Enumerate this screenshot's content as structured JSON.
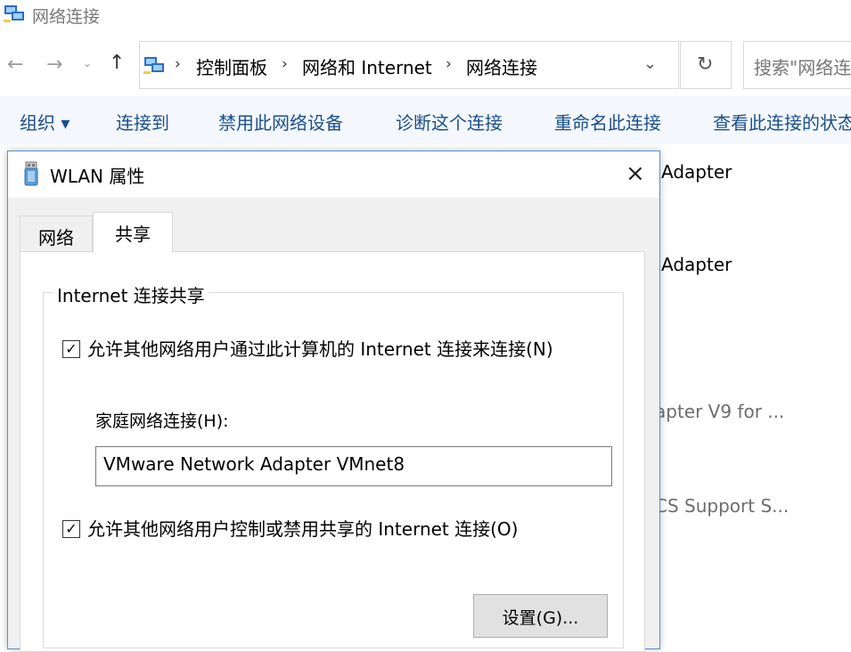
{
  "window": {
    "title": "网络连接"
  },
  "nav": {
    "back": "←",
    "forward": "→",
    "history": "⌄",
    "up": "↑",
    "refresh": "↻",
    "address_dropdown": "⌄"
  },
  "breadcrumb": {
    "items": [
      "控制面板",
      "网络和 Internet",
      "网络连接"
    ],
    "separator": "›"
  },
  "search": {
    "placeholder": "搜索\"网络连"
  },
  "command_bar": {
    "organize": "组织 ▾",
    "connect_to": "连接到",
    "disable_device": "禁用此网络设备",
    "diagnose": "诊断这个连接",
    "rename": "重命名此连接",
    "view_status": "查看此连接的状态"
  },
  "background_items": [
    "Adapter",
    "Adapter",
    "apter V9 for ...",
    "CS Support S..."
  ],
  "dialog": {
    "title": "WLAN 属性",
    "close": "×",
    "tabs": [
      "网络",
      "共享"
    ],
    "active_tab": "共享",
    "group_title": "Internet 连接共享",
    "allow_share": {
      "checked": true,
      "label": "允许其他网络用户通过此计算机的 Internet 连接来连接(N)"
    },
    "home_network": {
      "label": "家庭网络连接(H):",
      "value": "VMware Network Adapter VMnet8"
    },
    "allow_control": {
      "checked": true,
      "label": "允许其他网络用户控制或禁用共享的 Internet 连接(O)"
    },
    "settings_button": "设置(G)...",
    "checkmark": "✓"
  },
  "icons": {
    "title": "network-connections-icon",
    "address": "network-connections-icon",
    "dialog": "usb-wireless-adapter-icon"
  }
}
